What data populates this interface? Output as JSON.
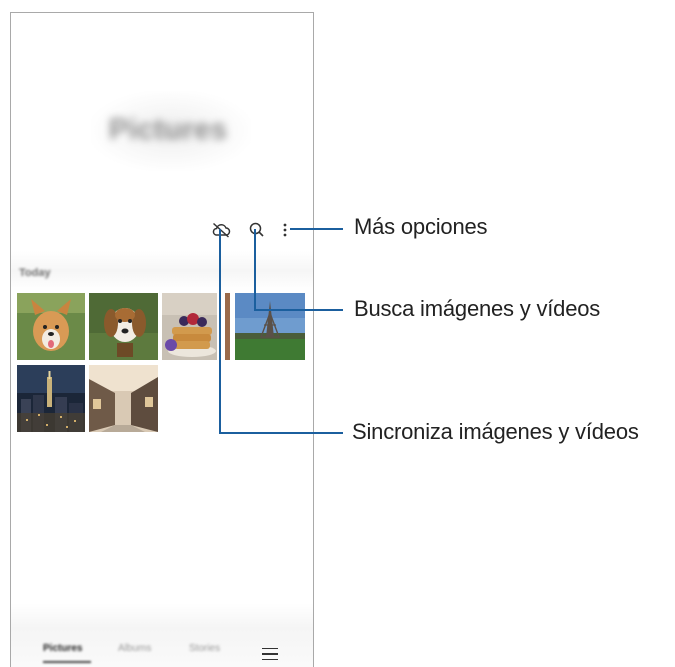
{
  "app": {
    "title": "Pictures"
  },
  "toolbar": {
    "icons": [
      "cloud-off-icon",
      "search-icon",
      "more-options-icon"
    ]
  },
  "section": {
    "label": "Today"
  },
  "bottom_nav": {
    "tabs": [
      "Pictures",
      "Albums",
      "Stories"
    ],
    "active_tab": "Pictures",
    "menu_icon": "hamburger-menu-icon"
  },
  "callouts": {
    "more_options": "Más opciones",
    "search": "Busca imágenes y vídeos",
    "sync": "Sincroniza imágenes y vídeos"
  },
  "colors": {
    "callout_line": "#1b5f9e"
  }
}
